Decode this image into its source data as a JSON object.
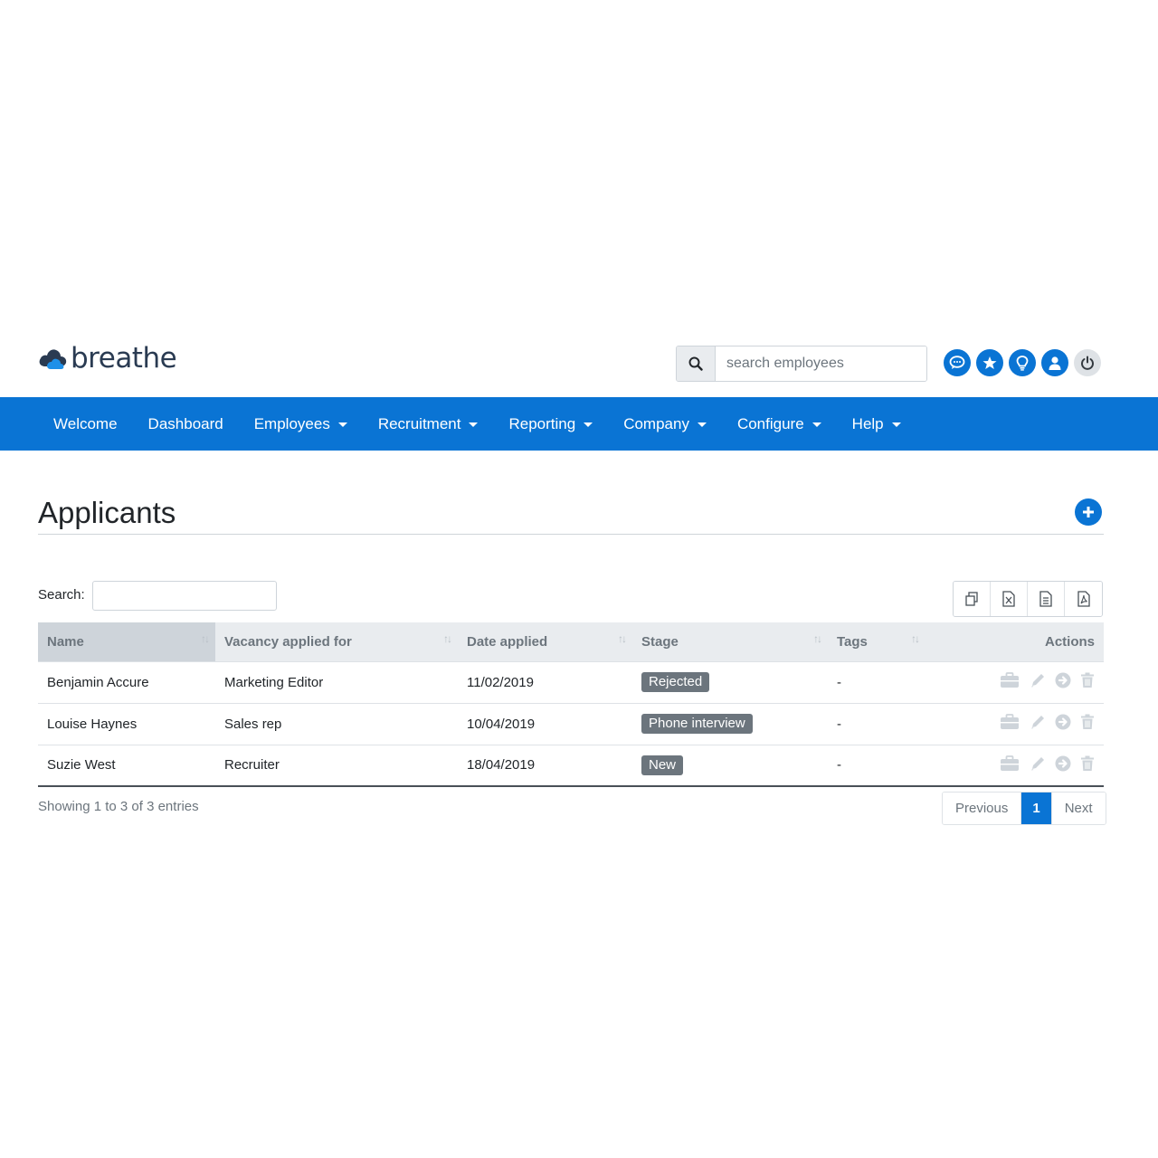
{
  "brand": {
    "name": "breathe"
  },
  "search": {
    "placeholder": "search employees"
  },
  "nav": [
    {
      "label": "Welcome",
      "dropdown": false
    },
    {
      "label": "Dashboard",
      "dropdown": false
    },
    {
      "label": "Employees",
      "dropdown": true
    },
    {
      "label": "Recruitment",
      "dropdown": true
    },
    {
      "label": "Reporting",
      "dropdown": true
    },
    {
      "label": "Company",
      "dropdown": true
    },
    {
      "label": "Configure",
      "dropdown": true
    },
    {
      "label": "Help",
      "dropdown": true
    }
  ],
  "page": {
    "title": "Applicants"
  },
  "filter": {
    "label": "Search:"
  },
  "table": {
    "columns": [
      "Name",
      "Vacancy applied for",
      "Date applied",
      "Stage",
      "Tags",
      "Actions"
    ],
    "rows": [
      {
        "name": "Benjamin Accure",
        "vacancy": "Marketing Editor",
        "date": "11/02/2019",
        "stage": "Rejected",
        "tags": "-"
      },
      {
        "name": "Louise Haynes",
        "vacancy": "Sales rep",
        "date": "10/04/2019",
        "stage": "Phone interview",
        "tags": "-"
      },
      {
        "name": "Suzie West",
        "vacancy": "Recruiter",
        "date": "18/04/2019",
        "stage": "New",
        "tags": "-"
      }
    ]
  },
  "footer": {
    "info": "Showing 1 to 3 of 3 entries",
    "previous": "Previous",
    "page": "1",
    "next": "Next"
  },
  "colors": {
    "primary": "#0a74d4",
    "badge": "#6c757d"
  }
}
